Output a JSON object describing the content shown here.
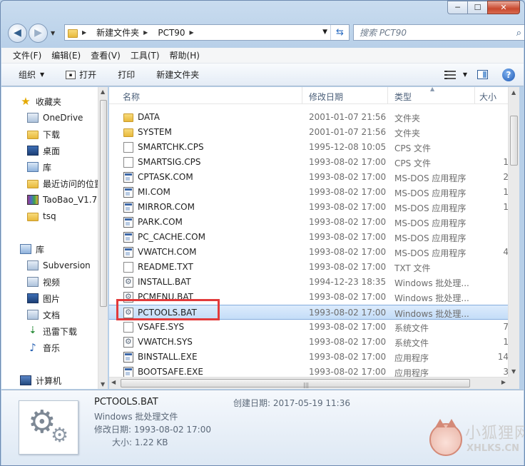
{
  "window": {
    "minimize": "─",
    "maximize": "☐",
    "close": "✕"
  },
  "address": {
    "crumbs": [
      "新建文件夹",
      "PCT90"
    ]
  },
  "search": {
    "placeholder": "搜索 PCT90"
  },
  "menu": [
    "文件(F)",
    "编辑(E)",
    "查看(V)",
    "工具(T)",
    "帮助(H)"
  ],
  "toolbar": {
    "organize": "组织",
    "open": "打开",
    "print": "打印",
    "new_folder": "新建文件夹"
  },
  "nav": {
    "favorites": "收藏夹",
    "onedrive": "OneDrive",
    "downloads": "下载",
    "desktop": "桌面",
    "library_fav": "库",
    "recent": "最近访问的位置",
    "taobao": "TaoBao_V1.7",
    "tsq": "tsq",
    "libraries": "库",
    "subversion": "Subversion",
    "videos": "视频",
    "pictures": "图片",
    "documents": "文档",
    "thunder": "迅雷下载",
    "music": "音乐",
    "computer": "计算机"
  },
  "columns": {
    "name": "名称",
    "date": "修改日期",
    "type": "类型",
    "size": "大小"
  },
  "files": [
    {
      "name": "DATA",
      "date": "2001-01-07 21:56",
      "type": "文件夹",
      "size": "",
      "icon": "folder"
    },
    {
      "name": "SYSTEM",
      "date": "2001-01-07 21:56",
      "type": "文件夹",
      "size": "",
      "icon": "folder"
    },
    {
      "name": "SMARTCHK.CPS",
      "date": "1995-12-08 10:05",
      "type": "CPS 文件",
      "size": "",
      "icon": "doc"
    },
    {
      "name": "SMARTSIG.CPS",
      "date": "1993-08-02 17:00",
      "type": "CPS 文件",
      "size": "1",
      "icon": "doc"
    },
    {
      "name": "CPTASK.COM",
      "date": "1993-08-02 17:00",
      "type": "MS-DOS 应用程序",
      "size": "2",
      "icon": "com"
    },
    {
      "name": "MI.COM",
      "date": "1993-08-02 17:00",
      "type": "MS-DOS 应用程序",
      "size": "1",
      "icon": "com"
    },
    {
      "name": "MIRROR.COM",
      "date": "1993-08-02 17:00",
      "type": "MS-DOS 应用程序",
      "size": "1",
      "icon": "com"
    },
    {
      "name": "PARK.COM",
      "date": "1993-08-02 17:00",
      "type": "MS-DOS 应用程序",
      "size": "",
      "icon": "com"
    },
    {
      "name": "PC_CACHE.COM",
      "date": "1993-08-02 17:00",
      "type": "MS-DOS 应用程序",
      "size": "",
      "icon": "com"
    },
    {
      "name": "VWATCH.COM",
      "date": "1993-08-02 17:00",
      "type": "MS-DOS 应用程序",
      "size": "4",
      "icon": "com"
    },
    {
      "name": "README.TXT",
      "date": "1993-08-02 17:00",
      "type": "TXT 文件",
      "size": "",
      "icon": "doc"
    },
    {
      "name": "INSTALL.BAT",
      "date": "1994-12-23 18:35",
      "type": "Windows 批处理...",
      "size": "",
      "icon": "bat"
    },
    {
      "name": "PCMENU.BAT",
      "date": "1993-08-02 17:00",
      "type": "Windows 批处理...",
      "size": "",
      "icon": "bat"
    },
    {
      "name": "PCTOOLS.BAT",
      "date": "1993-08-02 17:00",
      "type": "Windows 批处理...",
      "size": "",
      "icon": "bat",
      "selected": true
    },
    {
      "name": "VSAFE.SYS",
      "date": "1993-08-02 17:00",
      "type": "系统文件",
      "size": "7",
      "icon": "doc"
    },
    {
      "name": "VWATCH.SYS",
      "date": "1993-08-02 17:00",
      "type": "系统文件",
      "size": "1",
      "icon": "bat"
    },
    {
      "name": "BINSTALL.EXE",
      "date": "1993-08-02 17:00",
      "type": "应用程序",
      "size": "14",
      "icon": "com"
    },
    {
      "name": "BOOTSAFE.EXE",
      "date": "1993-08-02 17:00",
      "type": "应用程序",
      "size": "3",
      "icon": "com"
    }
  ],
  "details": {
    "name": "PCTOOLS.BAT",
    "type": "Windows 批处理文件",
    "modified": "修改日期: 1993-08-02 17:00",
    "size": "大小: 1.22 KB",
    "created": "创建日期: 2017-05-19 11:36"
  },
  "watermark": {
    "title": "小狐狸网",
    "url": "XHLKS.CN"
  }
}
